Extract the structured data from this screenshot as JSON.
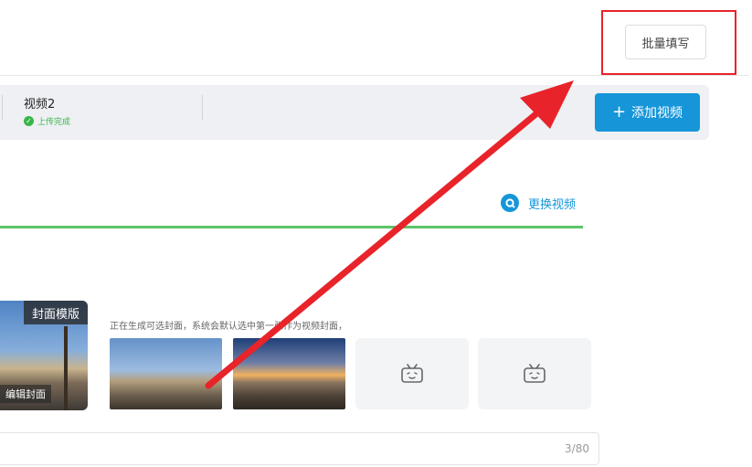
{
  "toolbar": {
    "batch_fill_label": "批量填写"
  },
  "video_strip": {
    "video_title": "视频2",
    "status": "上传完成",
    "add_video_label": "添加视频",
    "add_icon": "plus-icon"
  },
  "replace_video": {
    "label": "更换视频",
    "icon": "refresh-icon"
  },
  "cover": {
    "template_tag": "封面模版",
    "edit_tag": "编辑封面",
    "hint": "正在生成可选封面，系统会默认选中第一张作为视频封面，",
    "placeholder_icon": "bilibili-tv-icon"
  },
  "title_input": {
    "char_count": "3/80"
  },
  "colors": {
    "accent": "#1696d9",
    "success": "#39b54a",
    "annotation": "#e8232a"
  }
}
